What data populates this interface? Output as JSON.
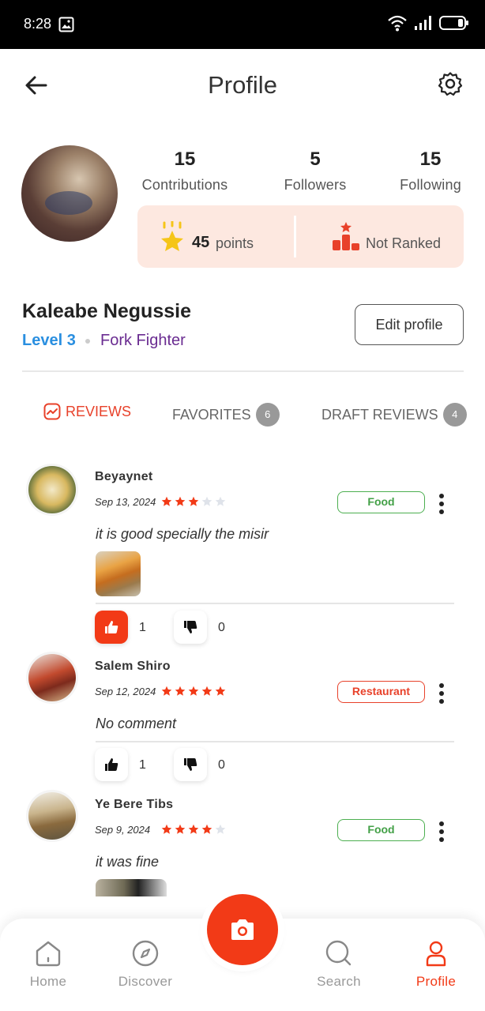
{
  "status_bar": {
    "time": "8:28"
  },
  "header": {
    "title": "Profile"
  },
  "stats": [
    {
      "value": "15",
      "label": "Contributions"
    },
    {
      "value": "5",
      "label": "Followers"
    },
    {
      "value": "15",
      "label": "Following"
    }
  ],
  "points": {
    "value": "45",
    "label": "points",
    "rank_label": "Not Ranked"
  },
  "user": {
    "name": "Kaleabe Negussie",
    "level": "Level 3",
    "title": "Fork Fighter",
    "edit_label": "Edit profile"
  },
  "tabs": [
    {
      "label": "REVIEWS",
      "active": true
    },
    {
      "label": "FAVORITES",
      "badge": "6"
    },
    {
      "label": "DRAFT REVIEWS",
      "badge": "4"
    }
  ],
  "reviews": [
    {
      "name": "Beyaynet",
      "date": "Sep 13, 2024",
      "rating": 3,
      "tag": "Food",
      "text": "it is good specially the misir",
      "likes": "1",
      "dislikes": "0",
      "liked": true
    },
    {
      "name": "Salem Shiro",
      "date": "Sep 12, 2024",
      "rating": 5,
      "tag": "Restaurant",
      "text": "No comment",
      "likes": "1",
      "dislikes": "0",
      "liked": false
    },
    {
      "name": "Ye Bere Tibs",
      "date": "Sep 9, 2024",
      "rating": 4,
      "tag": "Food",
      "text": "it was fine"
    }
  ],
  "nav": {
    "home": "Home",
    "discover": "Discover",
    "search": "Search",
    "profile": "Profile"
  },
  "colors": {
    "accent": "#f23a17",
    "food_tag": "#43a047",
    "level": "#2a8fe0",
    "title": "#6a2c91"
  }
}
